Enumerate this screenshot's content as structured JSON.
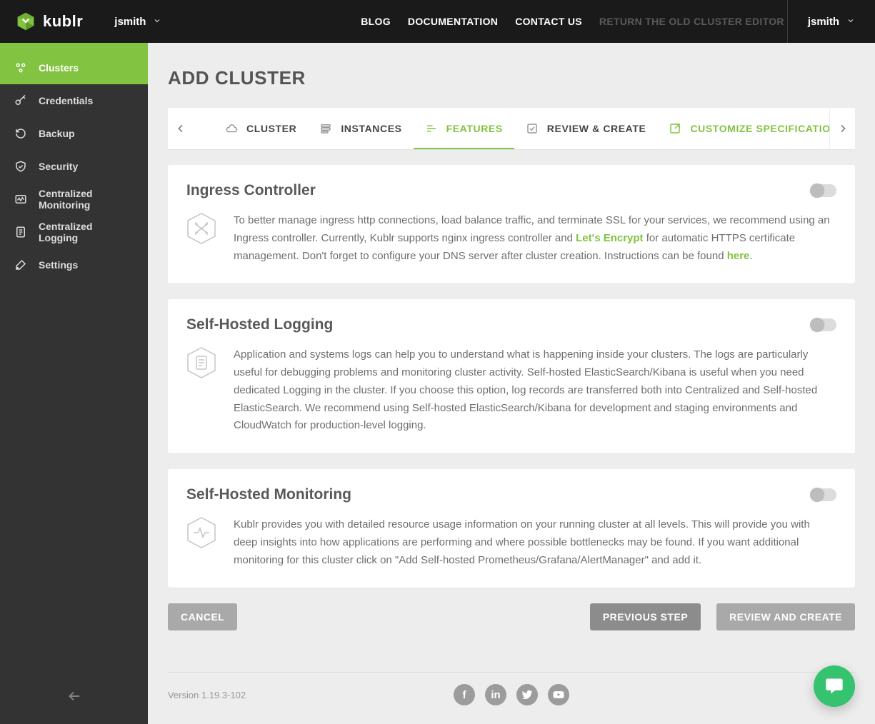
{
  "brand": "kublr",
  "header": {
    "userLeft": "jsmith",
    "nav": {
      "blog": "BLOG",
      "docs": "DOCUMENTATION",
      "contact": "CONTACT US",
      "old": "RETURN THE OLD CLUSTER EDITOR"
    },
    "userRight": "jsmith"
  },
  "sidebar": {
    "items": [
      {
        "label": "Clusters"
      },
      {
        "label": "Credentials"
      },
      {
        "label": "Backup"
      },
      {
        "label": "Security"
      },
      {
        "label": "Centralized Monitoring"
      },
      {
        "label": "Centralized Logging"
      },
      {
        "label": "Settings"
      }
    ]
  },
  "page": {
    "title": "ADD CLUSTER"
  },
  "stepper": {
    "items": [
      {
        "label": "CLUSTER"
      },
      {
        "label": "INSTANCES"
      },
      {
        "label": "FEATURES"
      },
      {
        "label": "REVIEW & CREATE"
      },
      {
        "label": "CUSTOMIZE SPECIFICATION"
      }
    ]
  },
  "cards": [
    {
      "title": "Ingress Controller",
      "text_pre": "To better manage ingress http connections, load balance traffic, and terminate SSL for your services, we recommend using an Ingress controller. Currently, Kublr supports nginx ingress controller and ",
      "link1": "Let's Encrypt",
      "text_mid": " for automatic HTTPS certificate management. Don't forget to configure your DNS server after cluster creation. Instructions can be found ",
      "link2": "here",
      "text_post": "."
    },
    {
      "title": "Self-Hosted Logging",
      "text": "Application and systems logs can help you to understand what is happening inside your clusters. The logs are particularly useful for debugging problems and monitoring cluster activity. Self-hosted ElasticSearch/Kibana is useful when you need dedicated Logging in the cluster. If you choose this option, log records are transferred both into Centralized and Self-hosted ElasticSearch. We recommend using Self-hosted ElasticSearch/Kibana for development and staging environments and CloudWatch for production-level logging."
    },
    {
      "title": "Self-Hosted Monitoring",
      "text": "Kublr provides you with detailed resource usage information on your running cluster at all levels. This will provide you with deep insights into how applications are performing and where possible bottlenecks may be found. If you want additional monitoring for this cluster click on \"Add Self-hosted Prometheus/Grafana/AlertManager\" and add it."
    }
  ],
  "footer": {
    "cancel": "CANCEL",
    "prev": "PREVIOUS STEP",
    "review": "REVIEW AND CREATE",
    "version": "Version 1.19.3-102"
  }
}
